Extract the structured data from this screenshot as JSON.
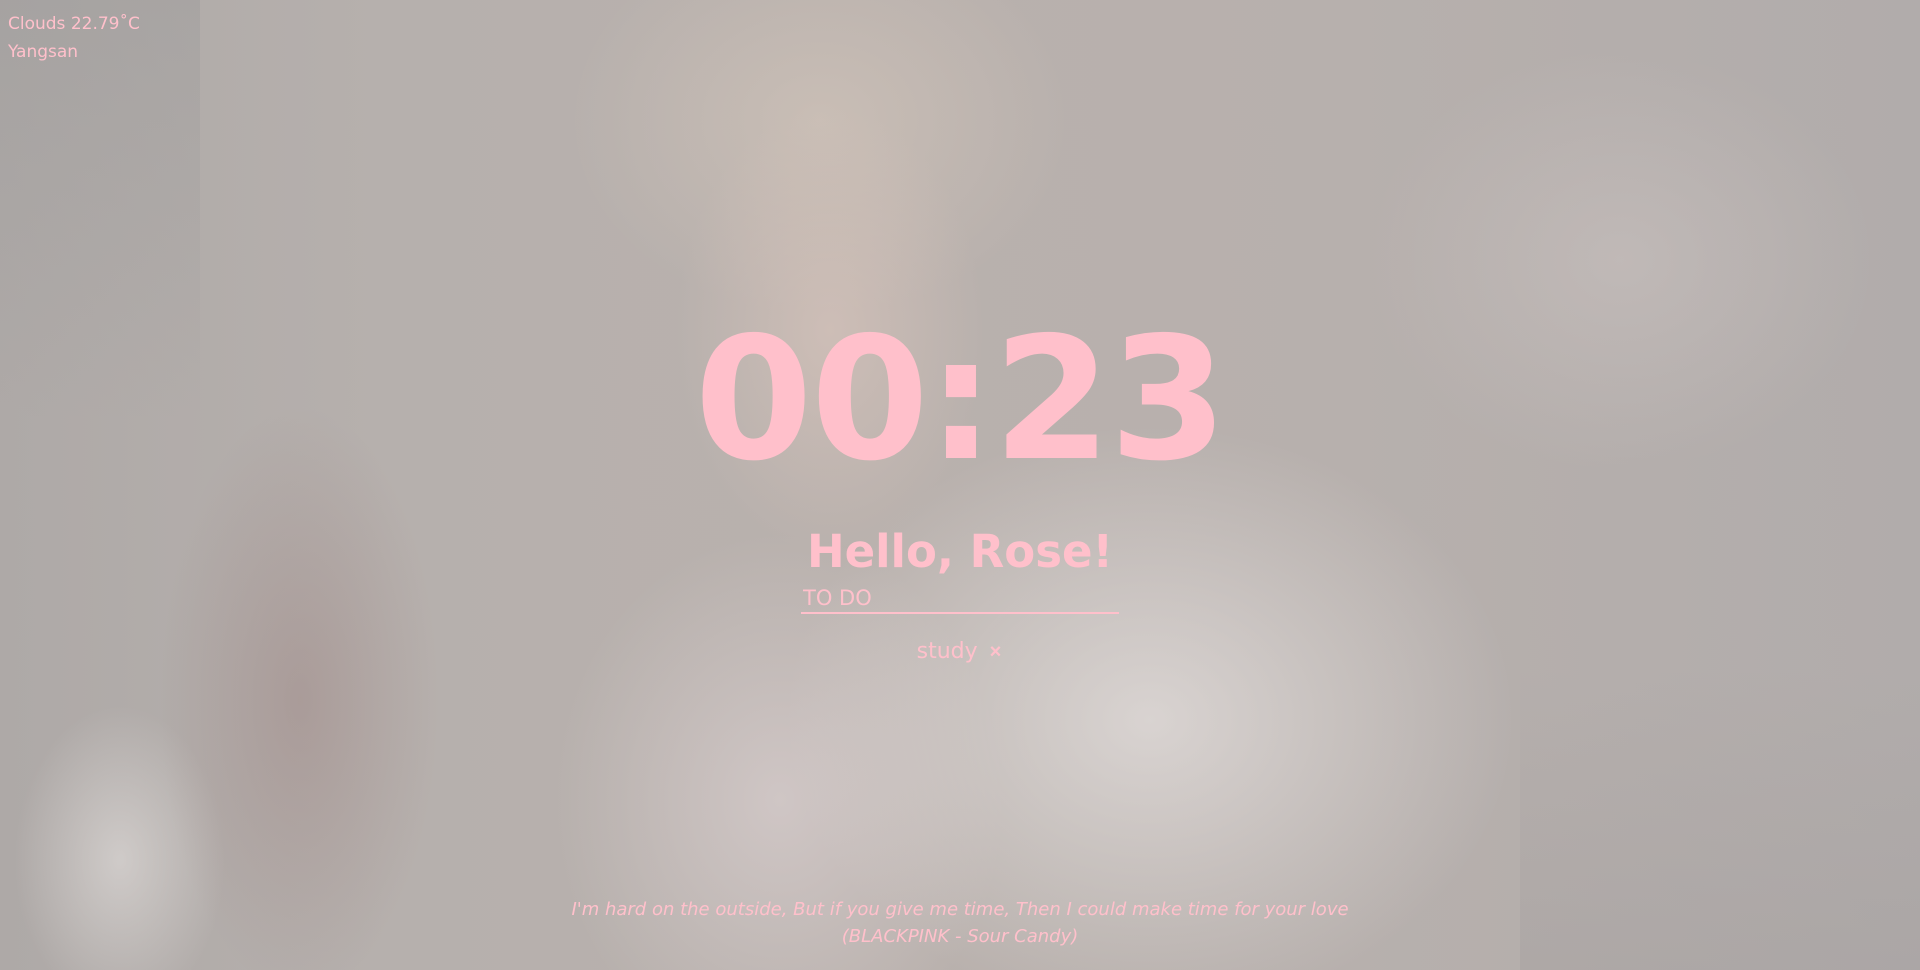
{
  "weather": {
    "condition_temp": "Clouds 22.79˚C",
    "city": "Yangsan"
  },
  "clock": {
    "time": "00:23"
  },
  "greeting": {
    "text": "Hello, Rose!"
  },
  "todo": {
    "placeholder": "TO DO",
    "items": [
      {
        "text": "study",
        "delete_label": "×"
      }
    ]
  },
  "quote": {
    "line": "I'm hard on the outside, But if you give me time, Then I could make time for your love",
    "author": "(BLACKPINK - Sour Candy)"
  },
  "colors": {
    "accent": "#ffc0cb"
  },
  "background": {
    "icon": "portrait-photo"
  }
}
